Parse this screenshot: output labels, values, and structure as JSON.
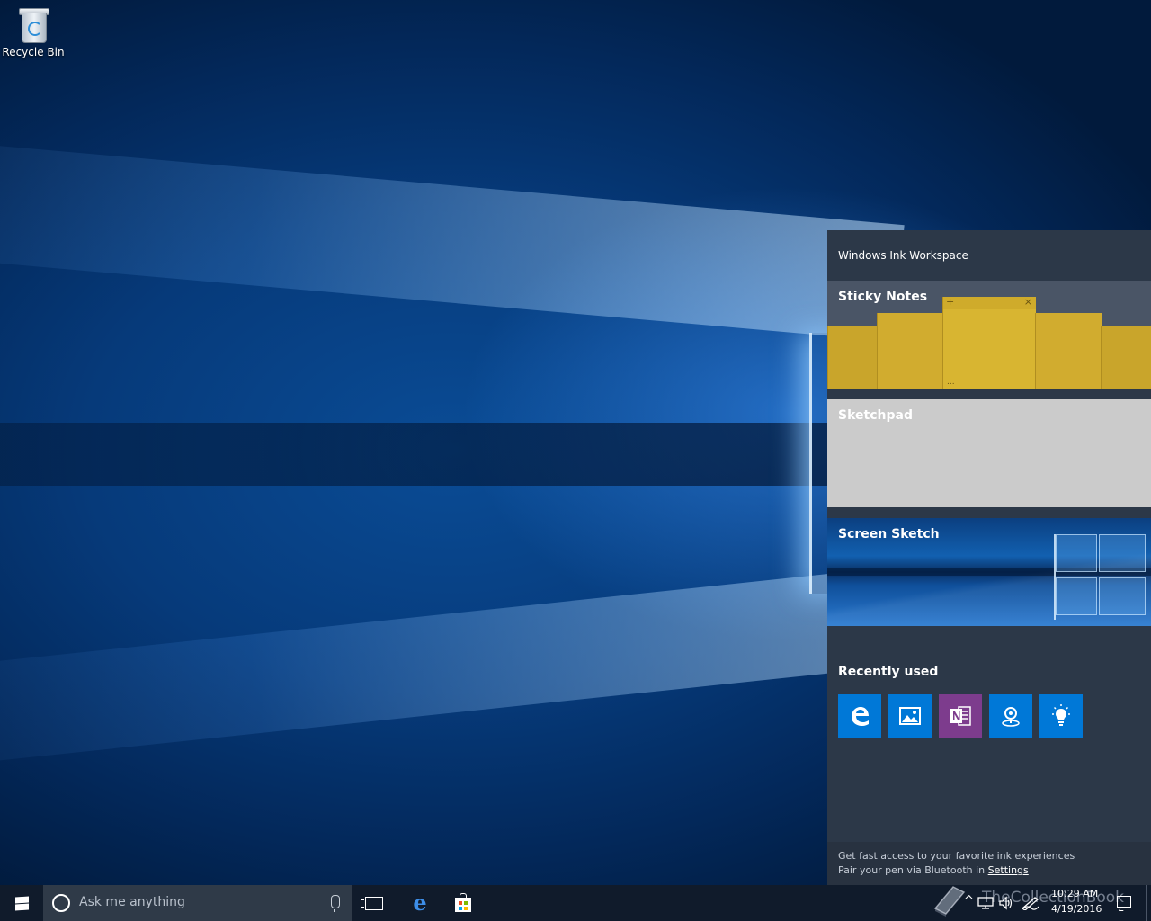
{
  "desktop": {
    "icons": [
      {
        "label": "Recycle Bin",
        "icon": "recycle-bin-icon"
      }
    ]
  },
  "ink_workspace": {
    "title": "Windows Ink Workspace",
    "cards": {
      "sticky_notes": "Sticky Notes",
      "sketchpad": "Sketchpad",
      "screen_sketch": "Screen Sketch"
    },
    "sticky_controls": {
      "add": "+",
      "close": "×",
      "more": "..."
    },
    "recently_used_title": "Recently used",
    "recent_apps": [
      {
        "name": "edge",
        "icon": "edge-icon",
        "color": "#0078d7"
      },
      {
        "name": "photos",
        "icon": "photos-icon",
        "color": "#0078d7"
      },
      {
        "name": "onenote",
        "icon": "onenote-icon",
        "color": "#7d3c8d"
      },
      {
        "name": "maps",
        "icon": "maps-icon",
        "color": "#0078d7"
      },
      {
        "name": "tips",
        "icon": "tips-icon",
        "color": "#0078d7"
      }
    ],
    "footer": {
      "line1": "Get fast access to your favorite ink experiences",
      "line2_prefix": "Pair your pen via Bluetooth in ",
      "line2_link": "Settings"
    }
  },
  "taskbar": {
    "search_placeholder": "Ask me anything",
    "pinned": [
      "task-view-icon",
      "edge-icon",
      "store-icon"
    ],
    "clock": {
      "time": "10:29 AM",
      "date": "4/19/2016"
    },
    "watermark": "TheCollectionBook"
  },
  "colors": {
    "accent": "#0078d7",
    "panel_bg": "#2c3848",
    "taskbar_bg": "#101b2b",
    "sticky_yellow": "#d8b531",
    "onenote_purple": "#7d3c8d"
  }
}
